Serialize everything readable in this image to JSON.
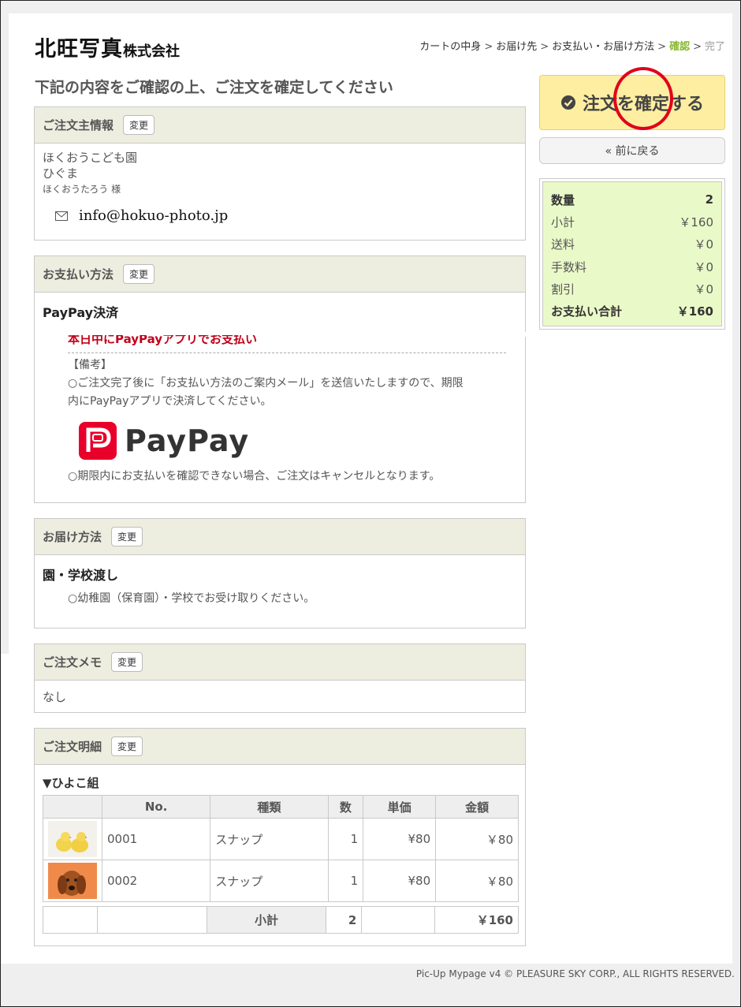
{
  "brand": {
    "name_big": "北旺写真",
    "name_small": "株式会社"
  },
  "breadcrumb": {
    "items": [
      "カートの中身",
      "お届け先",
      "お支払い・お届け方法"
    ],
    "current": "確認",
    "next": "完了",
    "separator": ">"
  },
  "heading": "下記の内容をご確認の上、ご注文を確定してください",
  "change_label": "変更",
  "orderer": {
    "title": "ご注文主情報",
    "school": "ほくおうこども園",
    "klass": "ひぐま",
    "name": "ほくおうたろう 様",
    "email": "info@hokuo-photo.jp"
  },
  "payment": {
    "title": "お支払い方法",
    "method": "PayPay決済",
    "deadline": "本日中にPayPayアプリでお支払い",
    "note_label": "【備考】",
    "note_line1": "○ご注文完了後に「お支払い方法のご案内メール」を送信いたしますので、期限",
    "note_line2": "内にPayPayアプリで決済してください。",
    "logo_text": "PayPay",
    "cancel_note": "○期限内にお支払いを確認できない場合、ご注文はキャンセルとなります。"
  },
  "delivery": {
    "title": "お届け方法",
    "method": "園・学校渡し",
    "note": "○幼稚園（保育園）・学校でお受け取りください。"
  },
  "memo": {
    "title": "ご注文メモ",
    "value": "なし"
  },
  "detail": {
    "title": "ご注文明細",
    "group": "▼ひよこ組",
    "columns": [
      "",
      "No.",
      "種類",
      "数",
      "単価",
      "金額"
    ],
    "rows": [
      {
        "no": "0001",
        "type": "スナップ",
        "qty": "1",
        "unit": "¥80",
        "amount": "￥80",
        "thumb": "chicks-photo"
      },
      {
        "no": "0002",
        "type": "スナップ",
        "qty": "1",
        "unit": "¥80",
        "amount": "￥80",
        "thumb": "dog-photo"
      }
    ],
    "subtotal_label": "小計",
    "subtotal_qty": "2",
    "subtotal_amount": "￥160"
  },
  "actions": {
    "confirm": "注文を確定する",
    "back": "« 前に戻る"
  },
  "summary": {
    "qty_label": "数量",
    "qty": "2",
    "subtotal_label": "小計",
    "subtotal": "￥160",
    "shipping_label": "送料",
    "shipping": "￥0",
    "fee_label": "手数料",
    "fee": "￥0",
    "discount_label": "割引",
    "discount": "￥0",
    "total_label": "お支払い合計",
    "total": "￥160"
  },
  "footer": "Pic-Up Mypage v4 © PLEASURE SKY CORP., ALL RIGHTS RESERVED.",
  "colors": {
    "accent_green": "#8ab832",
    "confirm_bg": "#fdeea1",
    "summary_bg": "#eaf9c8",
    "alert_red": "#c0001a",
    "panel_head": "#eeeee0"
  }
}
